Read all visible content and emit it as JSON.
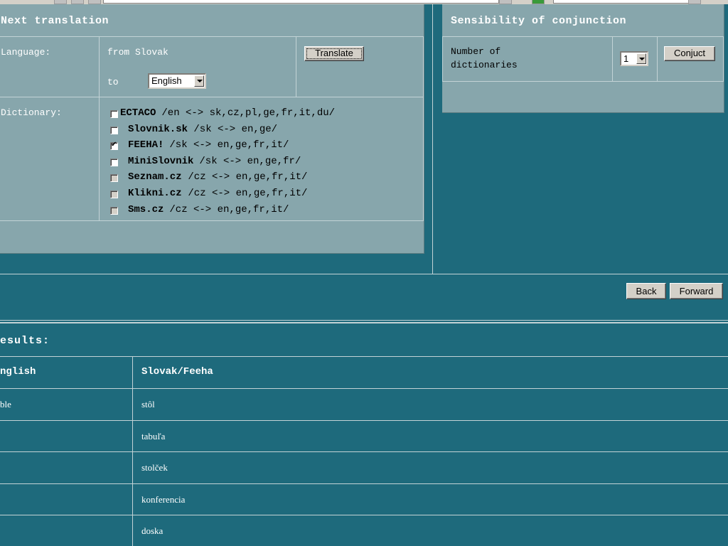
{
  "next_translation": {
    "title": "Next translation",
    "language_label": "Language:",
    "from_label": "from Slovak",
    "to_label": "to",
    "to_value": "English",
    "translate_button": "Translate",
    "dictionary_label": "Dictionary:",
    "dictionaries": [
      {
        "name": "ECTACO",
        "desc": " /en <-> sk,cz,pl,ge,fr,it,du/",
        "checked": false,
        "enabled": true
      },
      {
        "name": "Slovnik.sk",
        "desc": " /sk <-> en,ge/",
        "checked": false,
        "enabled": true
      },
      {
        "name": "FEEHA!",
        "desc": " /sk <-> en,ge,fr,it/",
        "checked": true,
        "enabled": true
      },
      {
        "name": "MiniSlovnik",
        "desc": " /sk <-> en,ge,fr/",
        "checked": false,
        "enabled": true
      },
      {
        "name": "Seznam.cz",
        "desc": " /cz <-> en,ge,fr,it/",
        "checked": false,
        "enabled": false
      },
      {
        "name": "Klikni.cz",
        "desc": " /cz <-> en,ge,fr,it/",
        "checked": false,
        "enabled": false
      },
      {
        "name": "Sms.cz",
        "desc": " /cz <-> en,ge,fr,it/",
        "checked": false,
        "enabled": false
      }
    ]
  },
  "conjunction": {
    "title": "Sensibility of conjunction",
    "number_label_line1": "Number of",
    "number_label_line2": "dictionaries",
    "number_value": "1",
    "conjunct_button": "Conjuct"
  },
  "nav": {
    "back_button": "Back",
    "forward_button": "Forward"
  },
  "results": {
    "title": "esults:",
    "col_english": "nglish",
    "col_slovak": "Slovak/Feeha",
    "rows": [
      {
        "en": "ble",
        "sk": "stôl"
      },
      {
        "en": "",
        "sk": "tabuľa"
      },
      {
        "en": "",
        "sk": "stolček"
      },
      {
        "en": "",
        "sk": "konferencia"
      },
      {
        "en": "",
        "sk": "doska"
      }
    ]
  }
}
